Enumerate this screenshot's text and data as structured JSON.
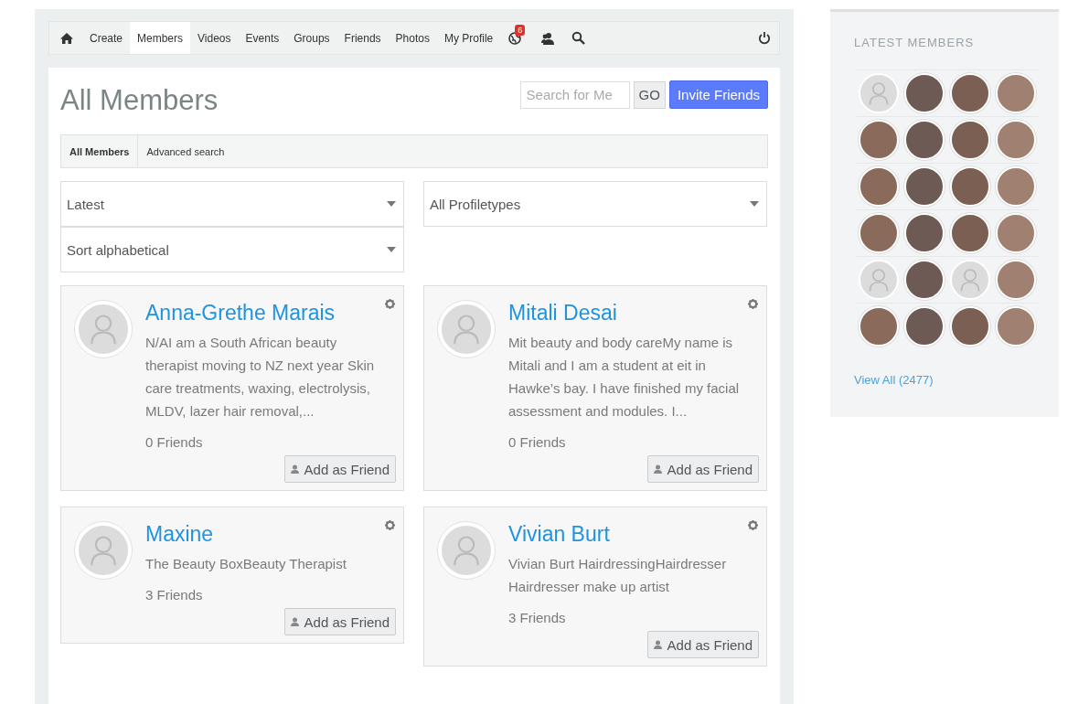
{
  "nav": {
    "items": [
      {
        "label": "Create",
        "selected": false
      },
      {
        "label": "Members",
        "selected": true
      },
      {
        "label": "Videos",
        "selected": false
      },
      {
        "label": "Events",
        "selected": false
      },
      {
        "label": "Groups",
        "selected": false
      },
      {
        "label": "Friends",
        "selected": false
      },
      {
        "label": "Photos",
        "selected": false
      },
      {
        "label": "My Profile",
        "selected": false
      }
    ],
    "notification_badge": "6"
  },
  "page": {
    "title": "All Members",
    "search": {
      "placeholder": "Search for Me"
    },
    "go_button": "GO",
    "invite_button": "Invite Friends"
  },
  "tabs": [
    {
      "label": "All Members",
      "selected": true
    },
    {
      "label": "Advanced search",
      "selected": false
    }
  ],
  "filters": [
    {
      "value": "Latest"
    },
    {
      "value": "All Profiletypes"
    },
    {
      "value": "Sort alphabetical"
    }
  ],
  "members": [
    {
      "name": "Anna-Grethe Marais",
      "description": "N/AI am a South African beauty therapist moving to NZ next year Skin care treatments, waxing, electrolysis, MLDV, lazer hair removal,...",
      "friends": "0 Friends",
      "button": "Add as Friend"
    },
    {
      "name": "Mitali Desai",
      "description": "Mit beauty and body careMy name is Mitali and I am a student at eit in Hawke’s bay. I have finished my facial assessment and modules. I...",
      "friends": "0 Friends",
      "button": "Add as Friend"
    },
    {
      "name": "Maxine",
      "description": "The Beauty BoxBeauty Therapist",
      "friends": "3 Friends",
      "button": "Add as Friend"
    },
    {
      "name": "Vivian Burt",
      "description": "Vivian Burt HairdressingHairdresser Hairdresser make up artist",
      "friends": "3 Friends",
      "button": "Add as Friend"
    }
  ],
  "sidebar": {
    "title": "LATEST MEMBERS",
    "avatars": [
      {
        "kind": "default"
      },
      {
        "kind": "photo"
      },
      {
        "kind": "photo"
      },
      {
        "kind": "photo"
      },
      {
        "kind": "photo"
      },
      {
        "kind": "photo"
      },
      {
        "kind": "photo"
      },
      {
        "kind": "photo"
      },
      {
        "kind": "photo"
      },
      {
        "kind": "photo"
      },
      {
        "kind": "photo"
      },
      {
        "kind": "photo"
      },
      {
        "kind": "photo"
      },
      {
        "kind": "photo"
      },
      {
        "kind": "photo"
      },
      {
        "kind": "photo"
      },
      {
        "kind": "default"
      },
      {
        "kind": "photo"
      },
      {
        "kind": "default"
      },
      {
        "kind": "photo"
      },
      {
        "kind": "photo"
      },
      {
        "kind": "photo"
      },
      {
        "kind": "photo"
      },
      {
        "kind": "photo"
      }
    ],
    "view_all": "View All (2477)"
  }
}
